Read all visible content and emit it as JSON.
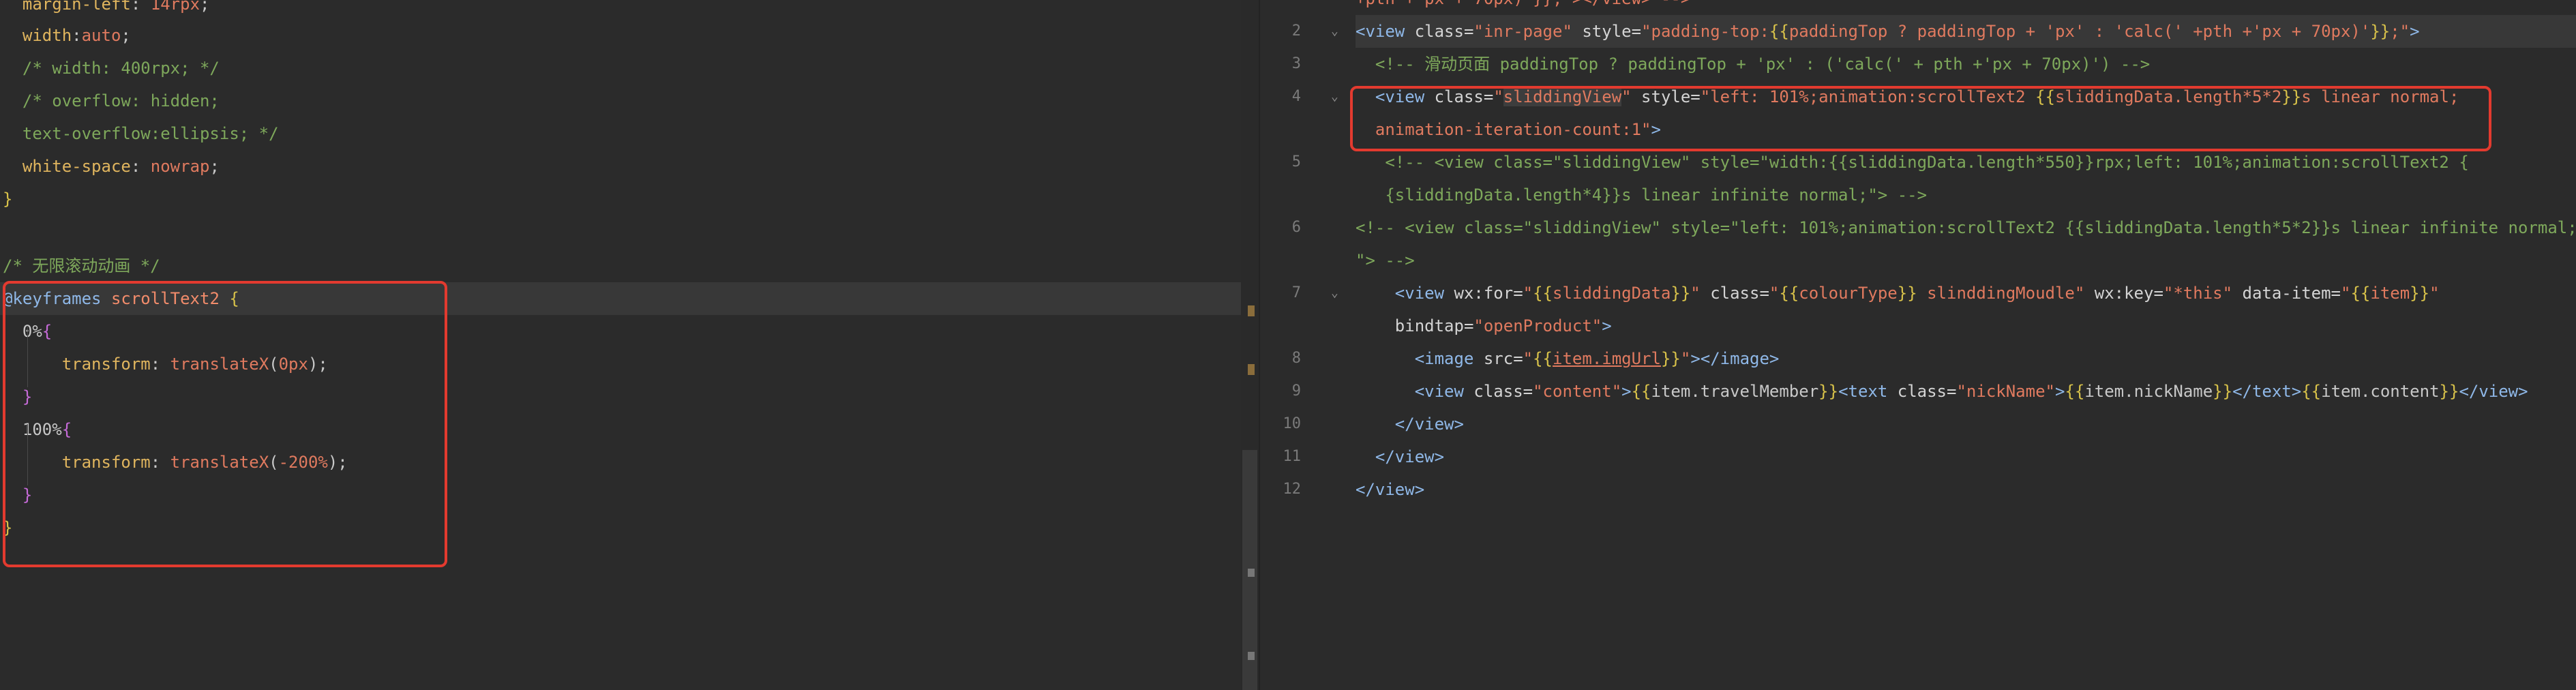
{
  "left": {
    "lines": [
      [
        {
          "t": "  "
        },
        {
          "t": "margin-left",
          "c": "c-prop"
        },
        {
          "t": ": "
        },
        {
          "t": "14rpx",
          "c": "c-val"
        },
        {
          "t": ";"
        }
      ],
      [
        {
          "t": "  "
        },
        {
          "t": "width",
          "c": "c-prop"
        },
        {
          "t": ":"
        },
        {
          "t": "auto",
          "c": "c-val"
        },
        {
          "t": ";"
        }
      ],
      [
        {
          "t": "  /* width: 400rpx; */",
          "c": "c-com"
        }
      ],
      [
        {
          "t": "  /* overflow: hidden;",
          "c": "c-com"
        }
      ],
      [
        {
          "t": "  text-overflow:ellipsis; */",
          "c": "c-com"
        }
      ],
      [
        {
          "t": "  "
        },
        {
          "t": "white-space",
          "c": "c-prop"
        },
        {
          "t": ": "
        },
        {
          "t": "nowrap",
          "c": "c-val"
        },
        {
          "t": ";"
        }
      ],
      [
        {
          "t": "}",
          "c": "c-brace"
        }
      ],
      [
        {
          "t": ""
        }
      ],
      [
        {
          "t": "/* 无限滚动动画 */",
          "c": "c-com"
        }
      ],
      [
        {
          "t": "@keyframes",
          "c": "c-kw"
        },
        {
          "t": " "
        },
        {
          "t": "scrollText2",
          "c": "c-name"
        },
        {
          "t": " "
        },
        {
          "t": "{",
          "c": "c-brace"
        }
      ],
      [
        {
          "t": "  0%"
        },
        {
          "t": "{",
          "c": "c-brace2"
        }
      ],
      [
        {
          "t": "      "
        },
        {
          "t": "transform",
          "c": "c-prop"
        },
        {
          "t": ": "
        },
        {
          "t": "translateX",
          "c": "c-val"
        },
        {
          "t": "("
        },
        {
          "t": "0px",
          "c": "c-num"
        },
        {
          "t": ");"
        }
      ],
      [
        {
          "t": "  "
        },
        {
          "t": "}",
          "c": "c-brace2"
        }
      ],
      [
        {
          "t": "  100%"
        },
        {
          "t": "{",
          "c": "c-brace2"
        }
      ],
      [
        {
          "t": "      "
        },
        {
          "t": "transform",
          "c": "c-prop"
        },
        {
          "t": ": "
        },
        {
          "t": "translateX",
          "c": "c-val"
        },
        {
          "t": "("
        },
        {
          "t": "-200%",
          "c": "c-num"
        },
        {
          "t": ");"
        }
      ],
      [
        {
          "t": "  "
        },
        {
          "t": "}",
          "c": "c-brace2"
        }
      ],
      [
        {
          "t": "}",
          "c": "c-brace"
        }
      ]
    ]
  },
  "right": {
    "top_fragment": "+pth + px + 70px) }}, ></view> -->",
    "lines": [
      {
        "num": "2",
        "fold": true,
        "segs": [
          {
            "t": "<view",
            "c": "r-tag"
          },
          {
            "t": " class=",
            "c": "r-attr"
          },
          {
            "t": "\"inr-page\"",
            "c": "r-str"
          },
          {
            "t": " style=",
            "c": "r-attr"
          },
          {
            "t": "\"padding-top:",
            "c": "r-str"
          },
          {
            "t": "{{",
            "c": "r-cur"
          },
          {
            "t": "paddingTop ? paddingTop + 'px' : 'calc(' +pth +'px + 70px)'",
            "c": "r-str"
          },
          {
            "t": "}}",
            "c": "r-cur"
          },
          {
            "t": ";\"",
            "c": "r-str"
          },
          {
            "t": ">",
            "c": "r-tag"
          }
        ]
      },
      {
        "num": "3",
        "fold": false,
        "segs": [
          {
            "t": "  <!-- 滑动页面 paddingTop ? paddingTop + 'px' : ('calc(' + pth +'px + 70px)') -->",
            "c": "r-com"
          }
        ]
      },
      {
        "num": "4",
        "fold": true,
        "segs": [
          {
            "t": "  "
          },
          {
            "t": "<view",
            "c": "r-tag"
          },
          {
            "t": " class=",
            "c": "r-attr"
          },
          {
            "t": "\"",
            "c": "r-str"
          },
          {
            "t": "sliddingView",
            "c": "r-str"
          },
          {
            "t": "\"",
            "c": "r-str"
          },
          {
            "t": " style=",
            "c": "r-attr"
          },
          {
            "t": "\"left: 101%;animation:scrollText2 ",
            "c": "r-str"
          },
          {
            "t": "{{",
            "c": "r-cur"
          },
          {
            "t": "sliddingData.length*5*2",
            "c": "r-str"
          },
          {
            "t": "}}",
            "c": "r-cur"
          },
          {
            "t": "s linear normal;",
            "c": "r-str"
          }
        ]
      },
      {
        "num": "",
        "fold": false,
        "segs": [
          {
            "t": "  animation-iteration-count:1\"",
            "c": "r-str"
          },
          {
            "t": ">",
            "c": "r-tag"
          }
        ]
      },
      {
        "num": "5",
        "fold": false,
        "segs": [
          {
            "t": "   <!-- <view class=\"sliddingView\" style=\"width:{{sliddingData.length*550}}rpx;left: 101%;animation:scrollText2 {",
            "c": "r-com"
          }
        ]
      },
      {
        "num": "",
        "fold": false,
        "segs": [
          {
            "t": "   {sliddingData.length*4}}s linear infinite normal;\"> -->",
            "c": "r-com"
          }
        ]
      },
      {
        "num": "6",
        "fold": false,
        "segs": [
          {
            "t": "<!-- <view class=\"sliddingView\" style=\"left: 101%;animation:scrollText2 {{sliddingData.length*5*2}}s linear infinite normal;",
            "c": "r-com"
          }
        ]
      },
      {
        "num": "",
        "fold": false,
        "segs": [
          {
            "t": "\"> -->",
            "c": "r-com"
          }
        ]
      },
      {
        "num": "7",
        "fold": true,
        "segs": [
          {
            "t": "    "
          },
          {
            "t": "<view",
            "c": "r-tag"
          },
          {
            "t": " wx:for=",
            "c": "r-attr"
          },
          {
            "t": "\"",
            "c": "r-str"
          },
          {
            "t": "{{",
            "c": "r-cur"
          },
          {
            "t": "sliddingData",
            "c": "r-str"
          },
          {
            "t": "}}",
            "c": "r-cur"
          },
          {
            "t": "\"",
            "c": "r-str"
          },
          {
            "t": " class=",
            "c": "r-attr"
          },
          {
            "t": "\"",
            "c": "r-str"
          },
          {
            "t": "{{",
            "c": "r-cur"
          },
          {
            "t": "colourType",
            "c": "r-str"
          },
          {
            "t": "}}",
            "c": "r-cur"
          },
          {
            "t": " slinddingMoudle\"",
            "c": "r-str"
          },
          {
            "t": " wx:key=",
            "c": "r-attr"
          },
          {
            "t": "\"*this\"",
            "c": "r-str"
          },
          {
            "t": " data-item=",
            "c": "r-attr"
          },
          {
            "t": "\"",
            "c": "r-str"
          },
          {
            "t": "{{",
            "c": "r-cur"
          },
          {
            "t": "item",
            "c": "r-str"
          },
          {
            "t": "}}",
            "c": "r-cur"
          },
          {
            "t": "\"",
            "c": "r-str"
          }
        ]
      },
      {
        "num": "",
        "fold": false,
        "segs": [
          {
            "t": "    bindtap=",
            "c": "r-attr"
          },
          {
            "t": "\"openProduct\"",
            "c": "r-str"
          },
          {
            "t": ">",
            "c": "r-tag"
          }
        ]
      },
      {
        "num": "8",
        "fold": false,
        "segs": [
          {
            "t": "      "
          },
          {
            "t": "<image",
            "c": "r-tag"
          },
          {
            "t": " src=",
            "c": "r-attr"
          },
          {
            "t": "\"",
            "c": "r-str"
          },
          {
            "t": "{{",
            "c": "r-cur"
          },
          {
            "t": "item.imgUrl",
            "c": "r-str"
          },
          {
            "t": "}}",
            "c": "r-cur"
          },
          {
            "t": "\"",
            "c": "r-str"
          },
          {
            "t": "></image>",
            "c": "r-tag"
          }
        ]
      },
      {
        "num": "9",
        "fold": false,
        "segs": [
          {
            "t": "      "
          },
          {
            "t": "<view",
            "c": "r-tag"
          },
          {
            "t": " class=",
            "c": "r-attr"
          },
          {
            "t": "\"content\"",
            "c": "r-str"
          },
          {
            "t": ">",
            "c": "r-tag"
          },
          {
            "t": "{{",
            "c": "r-cur"
          },
          {
            "t": "item.travelMember"
          },
          {
            "t": "}}",
            "c": "r-cur"
          },
          {
            "t": "<text",
            "c": "r-tag"
          },
          {
            "t": " class=",
            "c": "r-attr"
          },
          {
            "t": "\"nickName\"",
            "c": "r-str"
          },
          {
            "t": ">",
            "c": "r-tag"
          },
          {
            "t": "{{",
            "c": "r-cur"
          },
          {
            "t": "item.nickName"
          },
          {
            "t": "}}",
            "c": "r-cur"
          },
          {
            "t": "</text>",
            "c": "r-tag"
          },
          {
            "t": "{{",
            "c": "r-cur"
          },
          {
            "t": "item.content"
          },
          {
            "t": "}}",
            "c": "r-cur"
          },
          {
            "t": "</view>",
            "c": "r-tag"
          }
        ]
      },
      {
        "num": "10",
        "fold": false,
        "segs": [
          {
            "t": "    "
          },
          {
            "t": "</view>",
            "c": "r-tag"
          }
        ]
      },
      {
        "num": "11",
        "fold": false,
        "segs": [
          {
            "t": "  "
          },
          {
            "t": "</view>",
            "c": "r-tag"
          }
        ]
      },
      {
        "num": "12",
        "fold": false,
        "segs": [
          {
            "t": "</view>",
            "c": "r-tag"
          }
        ]
      }
    ]
  }
}
